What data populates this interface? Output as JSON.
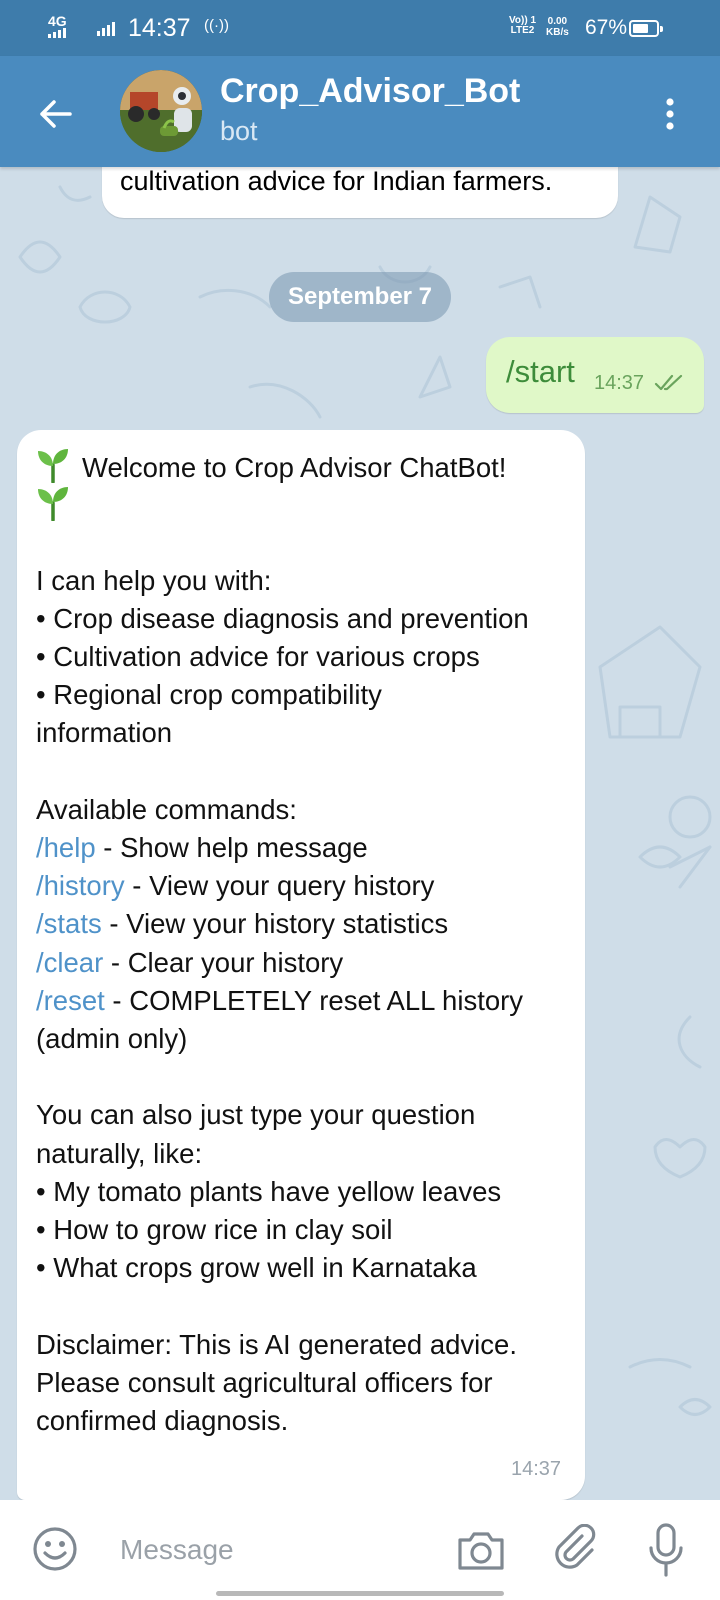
{
  "status_bar": {
    "network": "4G",
    "time": "14:37",
    "volte_line1": "Vo)) 1",
    "volte_line2": "LTE2",
    "speed_value": "0.00",
    "speed_unit": "KB/s",
    "battery_percent": "67%",
    "battery_level": 0.67
  },
  "header": {
    "title": "Crop_Advisor_Bot",
    "subtitle": "bot",
    "bg_color": "#4a8bbf"
  },
  "chat": {
    "prev_message_tail": "cultivation advice for Indian farmers.",
    "date_separator": "September 7",
    "outgoing": {
      "text": "/start",
      "time": "14:37",
      "status_icon": "double-check-icon"
    },
    "welcome": {
      "lines": [
        {
          "text": "Welcome to Crop Advisor ChatBot!",
          "icon": "sprout-icon"
        },
        {
          "text": "",
          "icon": "sprout-icon"
        },
        {
          "text": ""
        },
        {
          "text": "I can help you with:"
        },
        {
          "text": "• Crop disease diagnosis and prevention"
        },
        {
          "text": "• Cultivation advice for various crops"
        },
        {
          "text": "• Regional crop compatibility"
        },
        {
          "text": "information"
        },
        {
          "text": ""
        },
        {
          "text": "Available commands:"
        },
        {
          "cmd": "/help",
          "text": " - Show help message"
        },
        {
          "cmd": "/history",
          "text": " - View your query history"
        },
        {
          "cmd": "/stats",
          "text": " - View your history statistics"
        },
        {
          "cmd": "/clear",
          "text": " - Clear your history"
        },
        {
          "cmd": "/reset",
          "text": " - COMPLETELY reset ALL history"
        },
        {
          "text": "(admin only)"
        },
        {
          "text": ""
        },
        {
          "text": "You can also just type your question"
        },
        {
          "text": "naturally, like:"
        },
        {
          "text": "• My tomato plants have yellow leaves"
        },
        {
          "text": "• How to grow rice in clay soil"
        },
        {
          "text": "• What crops grow well in Karnataka"
        },
        {
          "text": ""
        },
        {
          "text": "Disclaimer: This is AI generated advice."
        },
        {
          "text": "Please consult agricultural officers for"
        },
        {
          "text": "confirmed diagnosis."
        }
      ],
      "time": "14:37",
      "command_color": "#4f92c9"
    }
  },
  "input_bar": {
    "placeholder": "Message",
    "icons": [
      "emoji-icon",
      "camera-icon",
      "attach-icon",
      "mic-icon"
    ]
  }
}
